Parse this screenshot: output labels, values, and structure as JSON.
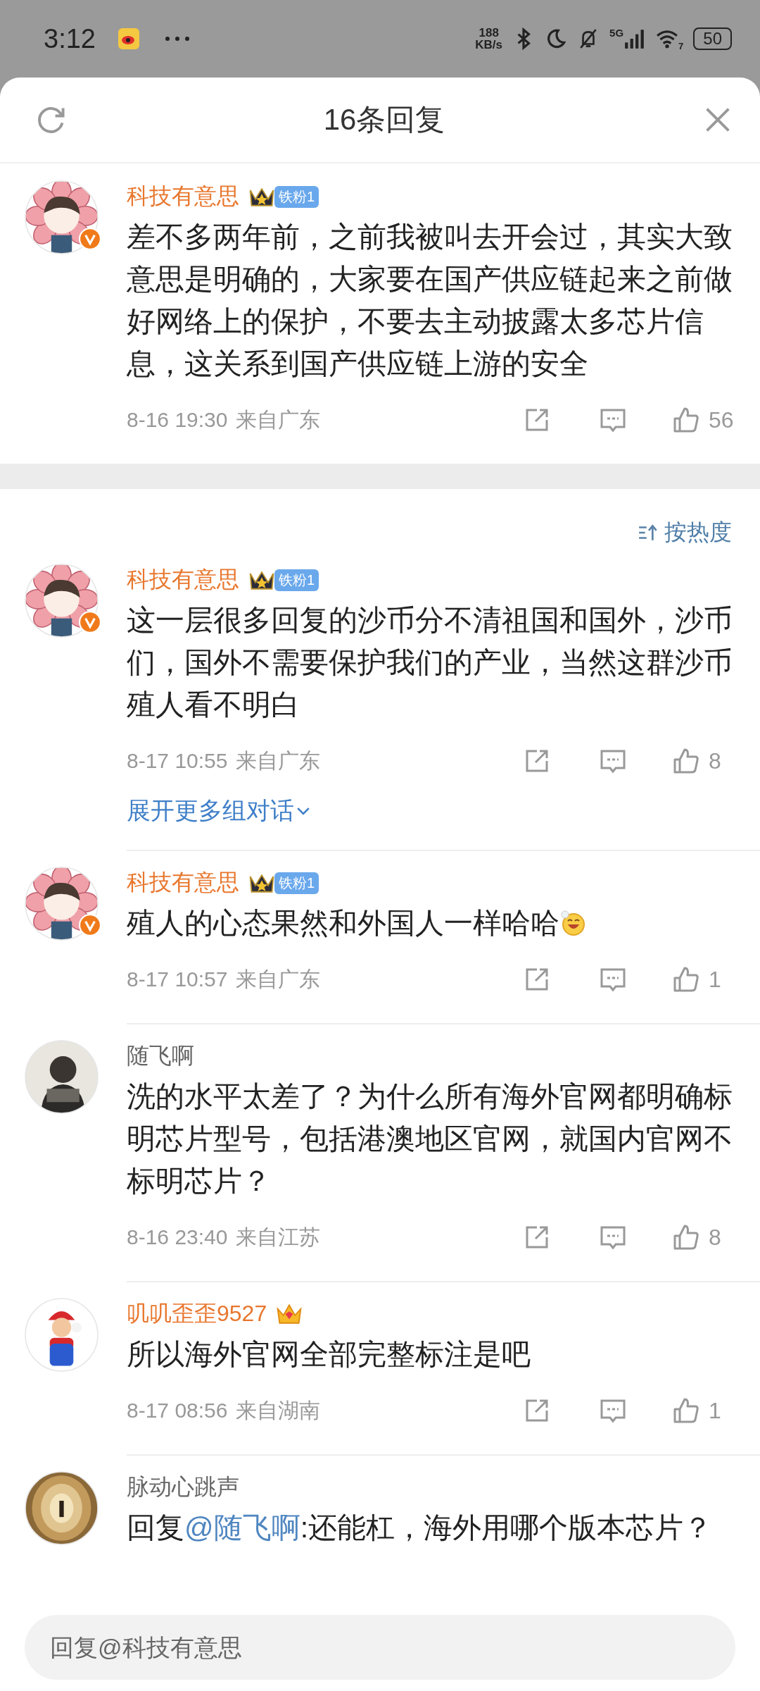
{
  "status_bar": {
    "time": "3:12",
    "net_speed": "188",
    "net_unit": "KB/s",
    "network": "5G",
    "wifi_gen": "7",
    "battery": "50"
  },
  "header": {
    "title": "16条回复"
  },
  "main_comment": {
    "name": "科技有意思",
    "vip": true,
    "verified": true,
    "badge": {
      "kind": "fan",
      "label": "铁粉1"
    },
    "text": "差不多两年前，之前我被叫去开会过，其实大致意思是明确的，大家要在国产供应链起来之前做好网络上的保护，不要去主动披露太多芯片信息，这关系到国产供应链上游的安全",
    "time": "8-16 19:30",
    "location": "来自广东",
    "likes": "56"
  },
  "sort": {
    "label": "按热度"
  },
  "replies": [
    {
      "name": "科技有意思",
      "vip": true,
      "verified": true,
      "badge": {
        "kind": "fan",
        "label": "铁粉1"
      },
      "text": "这一层很多回复的沙币分不清祖国和国外，沙币们，国外不需要保护我们的产业，当然这群沙币殖人看不明白",
      "time": "8-17 10:55",
      "location": "来自广东",
      "likes": "8",
      "expand": "展开更多组对话"
    },
    {
      "name": "科技有意思",
      "vip": true,
      "verified": true,
      "badge": {
        "kind": "fan",
        "label": "铁粉1"
      },
      "text": "殖人的心态果然和外国人一样哈哈",
      "emoji": true,
      "time": "8-17 10:57",
      "location": "来自广东",
      "likes": "1"
    },
    {
      "name": "随飞啊",
      "vip": false,
      "verified": false,
      "text": "洗的水平太差了？为什么所有海外官网都明确标明芯片型号，包括港澳地区官网，就国内官网不标明芯片？",
      "time": "8-16 23:40",
      "location": "来自江苏",
      "likes": "8"
    },
    {
      "name": "叽叽歪歪9527",
      "vip": true,
      "verified": false,
      "badge": {
        "kind": "member"
      },
      "text": "所以海外官网全部完整标注是吧",
      "time": "8-17 08:56",
      "location": "来自湖南",
      "likes": "1"
    },
    {
      "name": "脉动心跳声",
      "vip": false,
      "verified": false,
      "reply_prefix": "回复",
      "mention": "@随飞啊",
      "text": ":还能杠，海外用哪个版本芯片？"
    }
  ],
  "input": {
    "placeholder": "回复@科技有意思"
  }
}
